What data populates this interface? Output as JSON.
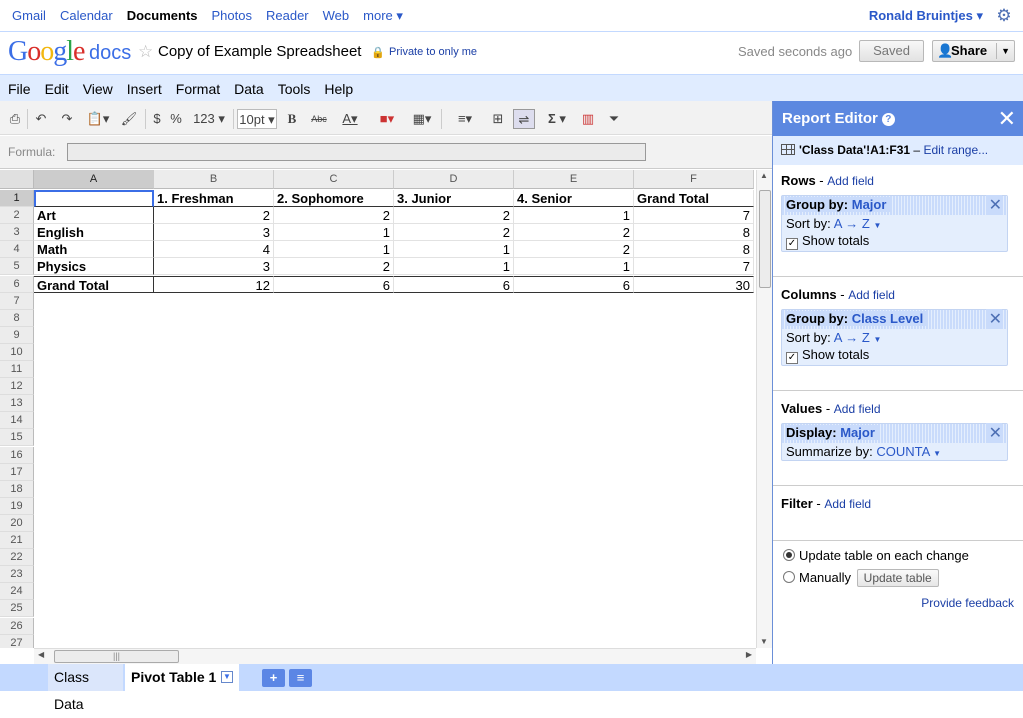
{
  "topnav": {
    "items": [
      "Gmail",
      "Calendar",
      "Documents",
      "Photos",
      "Reader",
      "Web",
      "more ▾"
    ],
    "active": "Documents",
    "user": "Ronald Bruintjes ▾"
  },
  "header": {
    "docs_label": "docs",
    "title": "Copy of Example Spreadsheet",
    "privacy": "Private to only me",
    "saved_status": "Saved seconds ago",
    "saved_button": "Saved",
    "share_button": "Share"
  },
  "menu": {
    "file": "File",
    "edit": "Edit",
    "view": "View",
    "insert": "Insert",
    "format": "Format",
    "data": "Data",
    "tools": "Tools",
    "help": "Help"
  },
  "toolbar": {
    "dollar": "$",
    "percent": "%",
    "number_format": "123 ▾",
    "font_size": "10pt ▾",
    "bold": "B",
    "strike": "Abc",
    "sigma": "Σ ▾"
  },
  "formula": {
    "label": "Formula:",
    "value": ""
  },
  "columns": [
    "A",
    "B",
    "C",
    "D",
    "E",
    "F"
  ],
  "rows": [
    "1",
    "2",
    "3",
    "4",
    "5",
    "6",
    "7",
    "8",
    "9",
    "10",
    "11",
    "12",
    "13",
    "14",
    "15",
    "16",
    "17",
    "18",
    "19",
    "20",
    "21",
    "22",
    "23",
    "24",
    "25",
    "26",
    "27"
  ],
  "pivot": {
    "header": [
      "",
      "1. Freshman",
      "2. Sophomore",
      "3. Junior",
      "4. Senior",
      "Grand Total"
    ],
    "data": [
      [
        "Art",
        "2",
        "2",
        "2",
        "1",
        "7"
      ],
      [
        "English",
        "3",
        "1",
        "2",
        "2",
        "8"
      ],
      [
        "Math",
        "4",
        "1",
        "1",
        "2",
        "8"
      ],
      [
        "Physics",
        "3",
        "2",
        "1",
        "1",
        "7"
      ],
      [
        "Grand Total",
        "12",
        "6",
        "6",
        "6",
        "30"
      ]
    ]
  },
  "tabs": {
    "sheet1": "Class Data",
    "sheet2": "Pivot Table 1",
    "add": "+",
    "list": "≡"
  },
  "report_editor": {
    "title": "Report Editor",
    "range": "'Class Data'!A1:F31",
    "edit_range": "Edit range...",
    "rows": {
      "title": "Rows",
      "add_field": "Add field",
      "group_label": "Group by:",
      "group_value": "Major",
      "sort_label": "Sort by:",
      "sort_value": "A → Z",
      "show_totals": "Show totals"
    },
    "columns": {
      "title": "Columns",
      "add_field": "Add field",
      "group_label": "Group by:",
      "group_value": "Class Level",
      "sort_label": "Sort by:",
      "sort_value": "A → Z",
      "show_totals": "Show totals"
    },
    "values": {
      "title": "Values",
      "add_field": "Add field",
      "display_label": "Display:",
      "display_value": "Major",
      "summarize_label": "Summarize by:",
      "summarize_value": "COUNTA"
    },
    "filter": {
      "title": "Filter",
      "add_field": "Add field"
    },
    "update_each": "Update table on each change",
    "manually": "Manually",
    "update_button": "Update table",
    "feedback": "Provide feedback"
  }
}
